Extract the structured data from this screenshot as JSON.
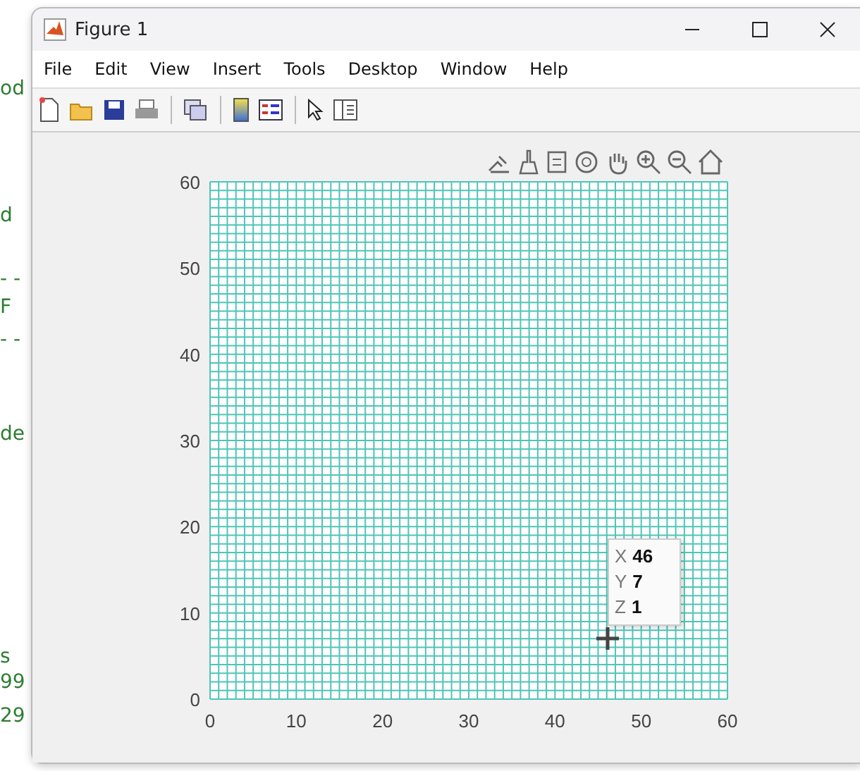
{
  "background_code": [
    "od",
    "d",
    "- -",
    "F",
    "- -",
    "de",
    "s",
    "99",
    "29"
  ],
  "window": {
    "title": "Figure 1"
  },
  "menu": [
    "File",
    "Edit",
    "View",
    "Insert",
    "Tools",
    "Desktop",
    "Window",
    "Help"
  ],
  "axes": {
    "xticks": [
      "0",
      "10",
      "20",
      "30",
      "40",
      "50",
      "60"
    ],
    "yticks": [
      "60",
      "50",
      "40",
      "30",
      "20",
      "10",
      "0"
    ]
  },
  "datatip": [
    {
      "axis": "X",
      "value": "46"
    },
    {
      "axis": "Y",
      "value": "7"
    },
    {
      "axis": "Z",
      "value": "1"
    }
  ]
}
